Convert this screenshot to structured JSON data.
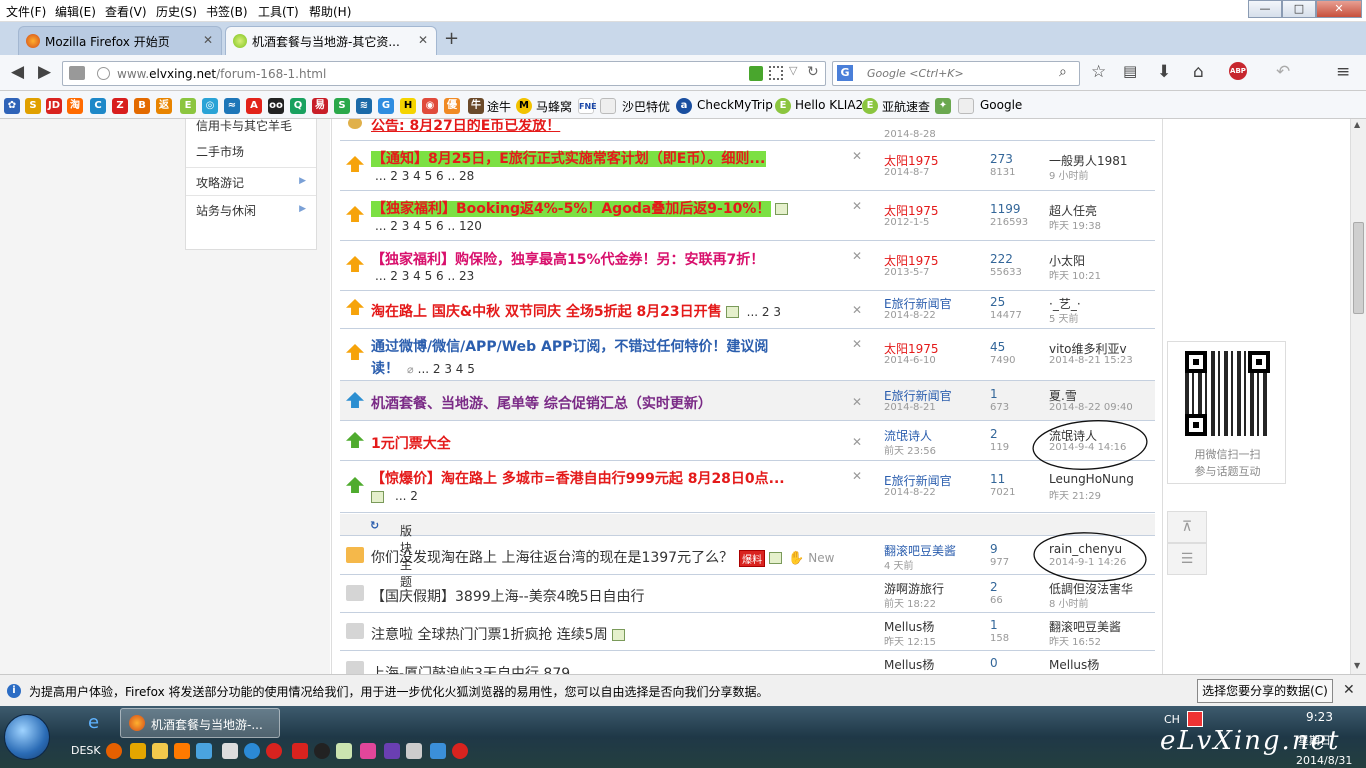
{
  "menu": [
    "文件(F)",
    "编辑(E)",
    "查看(V)",
    "历史(S)",
    "书签(B)",
    "工具(T)",
    "帮助(H)"
  ],
  "window_controls": {
    "minimize": "—",
    "maximize": "□",
    "close": "✕"
  },
  "tabs": [
    {
      "label": "Mozilla Firefox 开始页",
      "active": false,
      "icon": "firefox-icon"
    },
    {
      "label": "机酒套餐与当地游-其它资...",
      "active": true,
      "icon": "elvxing-icon"
    }
  ],
  "new_tab": "+",
  "url": {
    "prefix": "www.",
    "domain": "elvxing.net",
    "path": "/forum-168-1.html"
  },
  "search": {
    "placeholder": "Google <Ctrl+K>",
    "engine": "G"
  },
  "bookmarks": [
    "途牛",
    "马蜂窝",
    "沙巴特优",
    "CheckMyTrip",
    "Hello KLIA2",
    "亚航速查",
    "Google"
  ],
  "sidebar": {
    "items": [
      {
        "label": "信用卡与其它羊毛",
        "arrow": false
      },
      {
        "label": "二手市场",
        "arrow": false
      },
      {
        "label": "攻略游记",
        "arrow": true
      },
      {
        "label": "站务与休闲",
        "arrow": true
      }
    ]
  },
  "threads": {
    "top_partial": {
      "title": "公告: 8月27日的E币已发放！",
      "date": "2014-8-28"
    },
    "rows": [
      {
        "title": "【通知】8月25日，E旅行正式实施常客计划（即E币）。细则...",
        "pages": "... 2  3  4  5  6 .. 28",
        "author": "太阳1975",
        "adate": "2014-8-7",
        "replies": "273",
        "views": "8131",
        "last": "一般男人1981",
        "ldate": "9 小时前"
      },
      {
        "title": "【独家福利】Booking返4%-5%！Agoda叠加后返9-10%！",
        "pages": "... 2  3  4  5  6 .. 120",
        "author": "太阳1975",
        "adate": "2012-1-5",
        "replies": "1199",
        "views": "216593",
        "last": "超人任亮",
        "ldate": "昨天 19:38"
      },
      {
        "title": "【独家福利】购保险，独享最高15%代金券！另：安联再7折！",
        "pages": "... 2  3  4  5  6 .. 23",
        "author": "太阳1975",
        "adate": "2013-5-7",
        "replies": "222",
        "views": "55633",
        "last": "小太阳",
        "ldate": "昨天 10:21"
      },
      {
        "title": "淘在路上 国庆&中秋 双节同庆 全场5折起 8月23日开售",
        "pages": "... 2  3",
        "author": "E旅行新闻官",
        "adate": "2014-8-22",
        "replies": "25",
        "views": "14477",
        "last": "·_艺_·",
        "ldate": "5 天前"
      },
      {
        "title": "通过微博/微信/APP/Web APP订阅，不错过任何特价！建议阅",
        "title2": "读！",
        "pages": "... 2  3  4  5",
        "author": "太阳1975",
        "adate": "2014-6-10",
        "replies": "45",
        "views": "7490",
        "last": "vito维多利亚v",
        "ldate": "2014-8-21 15:23"
      },
      {
        "title": "机酒套餐、当地游、尾单等 综合促销汇总（实时更新）",
        "author": "E旅行新闻官",
        "adate": "2014-8-21",
        "replies": "1",
        "views": "673",
        "last": "夏.雪",
        "ldate": "2014-8-22 09:40"
      },
      {
        "title": "1元门票大全",
        "author": "流氓诗人",
        "adate": "前天 23:56",
        "replies": "2",
        "views": "119",
        "last": "流氓诗人",
        "ldate": "2014-9-4 14:16"
      },
      {
        "title": "【惊爆价】淘在路上 多城市=香港自由行999元起 8月28日0点...",
        "pages": "... 2",
        "author": "E旅行新闻官",
        "adate": "2014-8-22",
        "replies": "11",
        "views": "7021",
        "last": "LeungHoNung",
        "ldate": "昨天 21:29"
      }
    ],
    "section_label": "版块主题",
    "normal_rows": [
      {
        "title": "你们没发现淘在路上 上海往返台湾的现在是1397元了么？",
        "badge": "爆料",
        "new": "New",
        "author": "翻滚吧豆美酱",
        "adate": "4 天前",
        "replies": "9",
        "views": "977",
        "last": "rain_chenyu",
        "ldate": "2014-9-1 14:26"
      },
      {
        "title": "【国庆假期】3899上海--美奈4晚5日自由行",
        "author": "游啊游旅行",
        "adate": "前天 18:22",
        "replies": "2",
        "views": "66",
        "last": "低調但沒法害华",
        "ldate": "8 小时前"
      },
      {
        "title": "注意啦 全球热门门票1折疯抢 连续5周",
        "author": "Mellus杨",
        "adate": "昨天 12:15",
        "replies": "1",
        "views": "158",
        "last": "翻滚吧豆美酱",
        "ldate": "昨天 16:52"
      },
      {
        "title": "上海-厦门鼓浪屿3天自由行 879",
        "author": "Mellus杨",
        "adate": "",
        "replies": "0",
        "views": "",
        "last": "Mellus杨",
        "ldate": ""
      }
    ],
    "delete_symbol": "✕"
  },
  "qr": {
    "caption1": "用微信扫一扫",
    "caption2": "参与话题互动"
  },
  "notification": {
    "message": "为提高用户体验，Firefox 将发送部分功能的使用情况给我们，用于进一步优化火狐浏览器的易用性，您可以自由选择是否向我们分享数据。",
    "button": "选择您要分享的数据(C)",
    "close": "✕"
  },
  "taskbar": {
    "task_label": "机酒套餐与当地游-...",
    "desk": "DESK",
    "lang": "CH",
    "time": "9:23",
    "day": "星期日",
    "date": "2014/8/31",
    "watermark": "eLvXing.net"
  },
  "colors": {
    "accent": "#2b5eae",
    "red": "#e41a1a",
    "highlight": "#7ce043",
    "magenta": "#d8106c",
    "purple": "#7a2a86"
  }
}
